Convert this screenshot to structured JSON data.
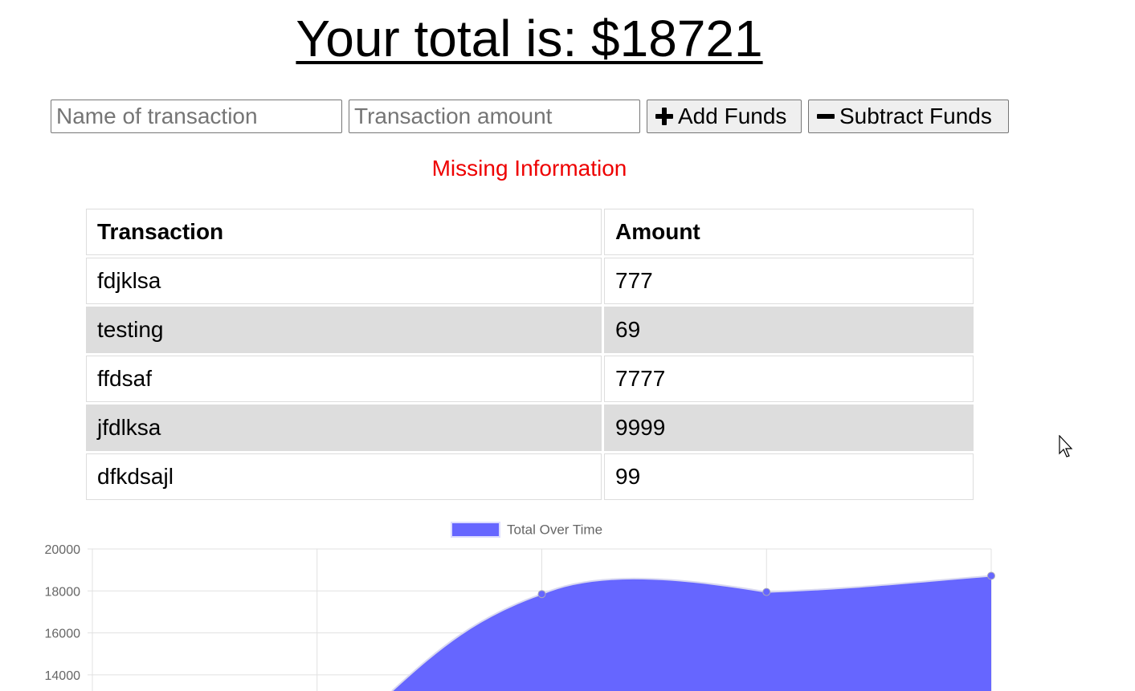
{
  "header": {
    "total_text": "Your total is: $18721"
  },
  "form": {
    "name_placeholder": "Name of transaction",
    "amount_placeholder": "Transaction amount",
    "add_label": "Add Funds",
    "subtract_label": "Subtract Funds",
    "add_icon": "plus-icon",
    "subtract_icon": "minus-icon"
  },
  "status": {
    "error_text": "Missing Information",
    "error_color": "#ee0000"
  },
  "table": {
    "headers": [
      "Transaction",
      "Amount"
    ],
    "rows": [
      {
        "name": "fdjklsa",
        "amount": "777"
      },
      {
        "name": "testing",
        "amount": "69"
      },
      {
        "name": "ffdsaf",
        "amount": "7777"
      },
      {
        "name": "jfdlksa",
        "amount": "9999"
      },
      {
        "name": "dfkdsajl",
        "amount": "99"
      }
    ]
  },
  "chart_data": {
    "type": "area",
    "series": [
      {
        "name": "Total Over Time",
        "color": "#6666ff",
        "values": [
          null,
          null,
          17850,
          17950,
          18721
        ]
      }
    ],
    "x": [
      "",
      "",
      "",
      "",
      ""
    ],
    "yticks": [
      20000,
      18000,
      16000,
      14000
    ],
    "ylim_visible": [
      13300,
      20000
    ],
    "grid": true,
    "legend_position": "top-center"
  }
}
